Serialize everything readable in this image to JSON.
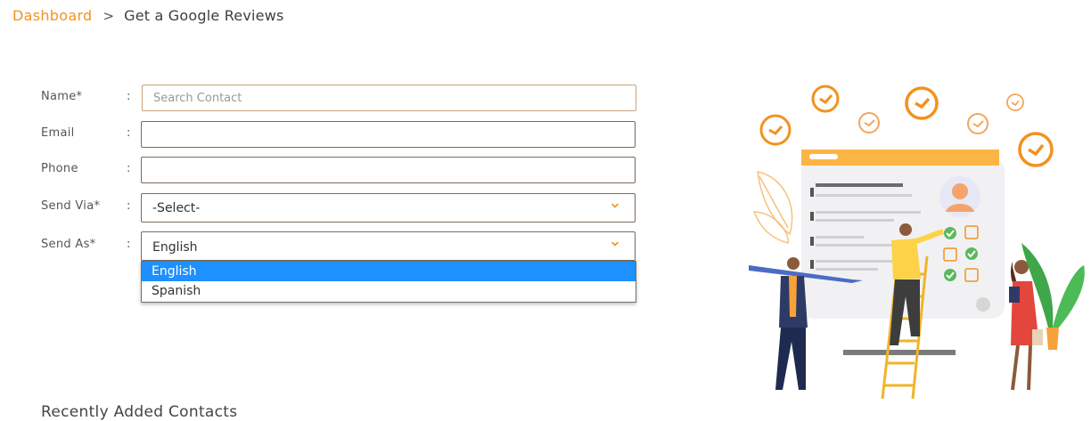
{
  "breadcrumb": {
    "root": "Dashboard",
    "separator": ">",
    "current": "Get a Google Reviews"
  },
  "form": {
    "name": {
      "label": "Name*",
      "placeholder": "Search Contact",
      "value": ""
    },
    "email": {
      "label": "Email",
      "value": ""
    },
    "phone": {
      "label": "Phone",
      "value": ""
    },
    "send_via": {
      "label": "Send Via*",
      "value": "-Select-"
    },
    "send_as": {
      "label": "Send As*",
      "value": "English",
      "options": [
        "English",
        "Spanish"
      ],
      "highlighted": "English"
    },
    "colon": ":"
  },
  "sections": {
    "recent_contacts_title": "Recently Added Contacts"
  },
  "colors": {
    "accent": "#f2921f",
    "selected_option": "#1e90ff",
    "illustration_yellow": "#fcd34d"
  },
  "icons": [
    "chevron-down-icon",
    "clock-icon",
    "check-icon",
    "person-icon",
    "pencil-icon"
  ]
}
